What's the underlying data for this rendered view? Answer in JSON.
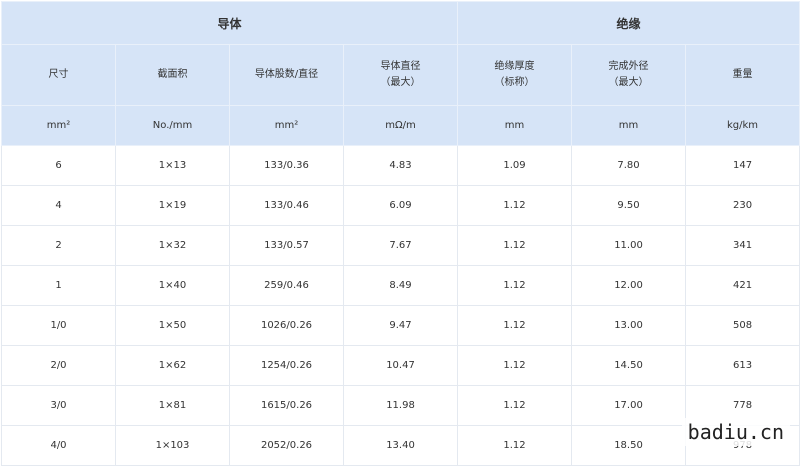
{
  "groups": {
    "conductor": "导体",
    "insulation": "绝缘"
  },
  "columns": [
    {
      "name": "尺寸",
      "sub": "",
      "unit": "mm²"
    },
    {
      "name": "截面积",
      "sub": "",
      "unit": "No./mm"
    },
    {
      "name": "导体股数/直径",
      "sub": "",
      "unit": "mm²"
    },
    {
      "name": "导体直径",
      "sub": "（最大）",
      "unit": "mΩ/m"
    },
    {
      "name": "绝缘厚度",
      "sub": "（标称）",
      "unit": "mm"
    },
    {
      "name": "完成外径",
      "sub": "（最大）",
      "unit": "mm"
    },
    {
      "name": "重量",
      "sub": "",
      "unit": "kg/km"
    }
  ],
  "rows": [
    [
      "6",
      "1×13",
      "133/0.36",
      "4.83",
      "1.09",
      "7.80",
      "147"
    ],
    [
      "4",
      "1×19",
      "133/0.46",
      "6.09",
      "1.12",
      "9.50",
      "230"
    ],
    [
      "2",
      "1×32",
      "133/0.57",
      "7.67",
      "1.12",
      "11.00",
      "341"
    ],
    [
      "1",
      "1×40",
      "259/0.46",
      "8.49",
      "1.12",
      "12.00",
      "421"
    ],
    [
      "1/0",
      "1×50",
      "1026/0.26",
      "9.47",
      "1.12",
      "13.00",
      "508"
    ],
    [
      "2/0",
      "1×62",
      "1254/0.26",
      "10.47",
      "1.12",
      "14.50",
      "613"
    ],
    [
      "3/0",
      "1×81",
      "1615/0.26",
      "11.98",
      "1.12",
      "17.00",
      "778"
    ],
    [
      "4/0",
      "1×103",
      "2052/0.26",
      "13.40",
      "1.12",
      "18.50",
      "978"
    ]
  ],
  "watermark": "badiu.cn"
}
